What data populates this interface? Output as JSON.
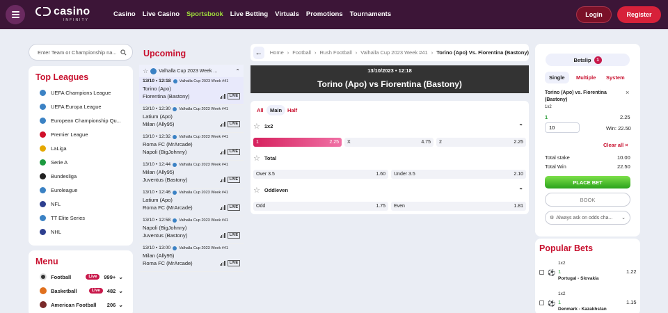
{
  "header": {
    "logo_text": "casino",
    "logo_sub": "INFINITY",
    "nav": [
      "Casino",
      "Live Casino",
      "Sportsbook",
      "Live Betting",
      "Virtuals",
      "Promotions",
      "Tournaments"
    ],
    "active_nav": "Sportsbook",
    "login": "Login",
    "register": "Register"
  },
  "search": {
    "placeholder": "Enter Team or Championship na..."
  },
  "top_leagues": {
    "title": "Top Leagues",
    "items": [
      {
        "label": "UEFA Champions League",
        "icon": "globe-icon",
        "color": "#3b82c4"
      },
      {
        "label": "UEFA Europa League",
        "icon": "globe-icon",
        "color": "#3b82c4"
      },
      {
        "label": "European Championship Qu...",
        "icon": "globe-icon",
        "color": "#3b82c4"
      },
      {
        "label": "Premier League",
        "icon": "england-flag-icon",
        "color": "#d0102a"
      },
      {
        "label": "LaLiga",
        "icon": "spain-flag-icon",
        "color": "#e5a800"
      },
      {
        "label": "Serie A",
        "icon": "italy-flag-icon",
        "color": "#1c9a3f"
      },
      {
        "label": "Bundesliga",
        "icon": "germany-flag-icon",
        "color": "#222222"
      },
      {
        "label": "Euroleague",
        "icon": "globe-icon",
        "color": "#3b82c4"
      },
      {
        "label": "NFL",
        "icon": "usa-flag-icon",
        "color": "#2d3f8f"
      },
      {
        "label": "TT Elite Series",
        "icon": "globe-icon",
        "color": "#3b82c4"
      },
      {
        "label": "NHL",
        "icon": "usa-flag-icon",
        "color": "#2d3f8f"
      }
    ]
  },
  "menu": {
    "title": "Menu",
    "items": [
      {
        "label": "Football",
        "live": "Live",
        "count": "999+",
        "icon": "football-icon"
      },
      {
        "label": "Basketball",
        "live": "Live",
        "count": "482",
        "icon": "basketball-icon"
      },
      {
        "label": "American Football",
        "live": "",
        "count": "206",
        "icon": "american-football-icon"
      }
    ]
  },
  "upcoming": {
    "title": "Upcoming",
    "league_header": "Valhalla Cup 2023 Week ...",
    "matches": [
      {
        "time": "13/10 • 12:18",
        "league": "Valhalla Cup 2023 Week #41",
        "home": "Torino (Apo)",
        "away": "Fiorentina (Bastony)",
        "live": "LIVE",
        "selected": true
      },
      {
        "time": "13/10 • 12:30",
        "league": "Valhalla Cup 2023 Week #41",
        "home": "Latium (Apo)",
        "away": "Milan (Ally95)",
        "live": "LIVE",
        "selected": false
      },
      {
        "time": "13/10 • 12:32",
        "league": "Valhalla Cup 2023 Week #41",
        "home": "Roma FC (MrArcade)",
        "away": "Napoli (BigJohnny)",
        "live": "LIVE",
        "selected": false
      },
      {
        "time": "13/10 • 12:44",
        "league": "Valhalla Cup 2023 Week #41",
        "home": "Milan (Ally95)",
        "away": "Juventus (Bastony)",
        "live": "LIVE",
        "selected": false
      },
      {
        "time": "13/10 • 12:46",
        "league": "Valhalla Cup 2023 Week #41",
        "home": "Latium (Apo)",
        "away": "Roma FC (MrArcade)",
        "live": "LIVE",
        "selected": false
      },
      {
        "time": "13/10 • 12:58",
        "league": "Valhalla Cup 2023 Week #41",
        "home": "Napoli (BigJohnny)",
        "away": "Juventus (Bastony)",
        "live": "LIVE",
        "selected": false
      },
      {
        "time": "13/10 • 13:00",
        "league": "Valhalla Cup 2023 Week #41",
        "home": "Milan (Ally95)",
        "away": "Roma FC (MrArcade)",
        "live": "LIVE",
        "selected": false
      }
    ]
  },
  "breadcrumb": {
    "items": [
      "Home",
      "Football",
      "Rush Football",
      "Valhalla Cup 2023 Week #41"
    ],
    "current": "Torino (Apo) Vs. Fiorentina (Bastony)"
  },
  "event": {
    "datetime": "13/10/2023 • 12:18",
    "home": "Torino (Apo)",
    "vs": "vs",
    "away": "Fiorentina (Bastony)"
  },
  "market_tabs": [
    "All",
    "Main",
    "Half"
  ],
  "active_market_tab": "Main",
  "markets": [
    {
      "title": "1x2",
      "odds": [
        {
          "label": "1",
          "value": "2.25",
          "selected": true
        },
        {
          "label": "X",
          "value": "4.75"
        },
        {
          "label": "2",
          "value": "2.25"
        }
      ]
    },
    {
      "title": "Total",
      "odds": [
        {
          "label": "Over 3.5",
          "value": "1.60"
        },
        {
          "label": "Under 3.5",
          "value": "2.10"
        }
      ]
    },
    {
      "title": "Odd/even",
      "odds": [
        {
          "label": "Odd",
          "value": "1.75"
        },
        {
          "label": "Even",
          "value": "1.81"
        }
      ]
    }
  ],
  "betslip": {
    "title": "Betslip",
    "count": "1",
    "tabs": [
      "Single",
      "Multiple",
      "System"
    ],
    "active_tab": "Single",
    "bet": {
      "event": "Torino (Apo) vs. Fiorentina (Bastony)",
      "market": "1x2",
      "pick": "1",
      "odds": "2.25",
      "stake": "10",
      "win": "Win: 22.50"
    },
    "clear_all": "Clear all",
    "total_stake_label": "Total stake",
    "total_stake": "10.00",
    "total_win_label": "Total Win",
    "total_win": "22.50",
    "place_bet": "PLACE BET",
    "book": "BOOK",
    "odds_change": "Always ask on odds cha..."
  },
  "popular_bets": {
    "title": "Popular Bets",
    "items": [
      {
        "market": "1x2",
        "pick": "1",
        "match": "Portugal - Slovakia",
        "odds": "1.22"
      },
      {
        "market": "1x2",
        "pick": "1",
        "match": "Denmark - Kazakhstan",
        "odds": "1.15"
      }
    ]
  },
  "colors": {
    "header_bg": "#3c1537",
    "accent_red": "#c8102e",
    "active_green": "#9edb3b",
    "place_bet_green": "#3fbf2a"
  }
}
